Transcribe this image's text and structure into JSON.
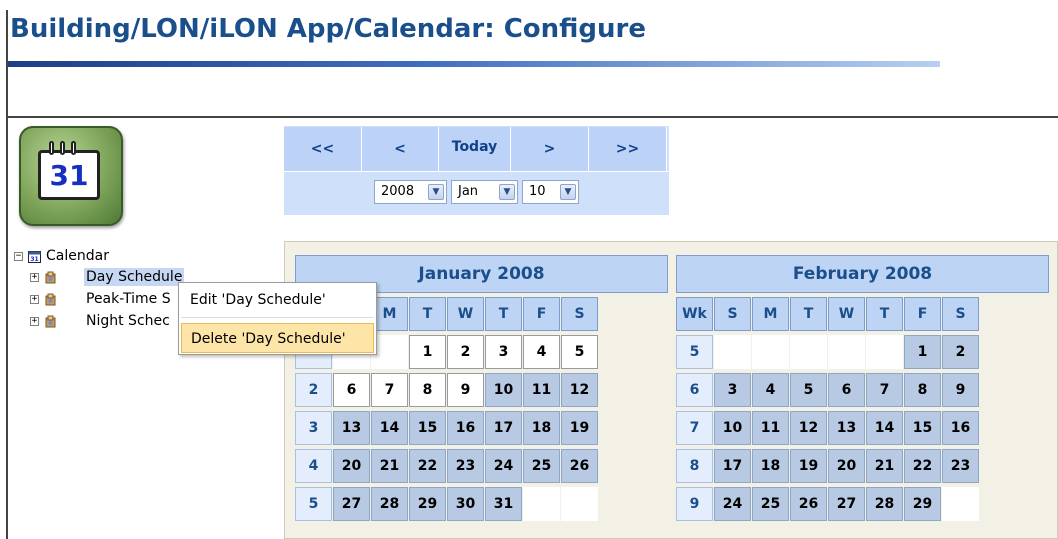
{
  "page": {
    "title": "Building/LON/iLON App/Calendar: Configure",
    "icon_day": "31"
  },
  "colors": {
    "title": "#1a4f8c",
    "nav_bg": "#cfe0fb",
    "header_cell": "#bdd4f5",
    "day_cell": "#b8cae3",
    "menu_hover": "#fde5a8"
  },
  "nav": {
    "first": "<<",
    "prev": "<",
    "today": "Today",
    "next": ">",
    "last": ">>",
    "year": "2008",
    "month": "Jan",
    "day": "10"
  },
  "tree": {
    "root": "Calendar",
    "items": [
      "Day Schedule",
      "Peak-Time S",
      "Night Schec"
    ]
  },
  "context_menu": {
    "items": [
      "Edit 'Day Schedule'",
      "Delete 'Day Schedule'"
    ],
    "hovered_index": 1
  },
  "calendar": {
    "weekday_headers": [
      "Wk",
      "S",
      "M",
      "T",
      "W",
      "T",
      "F",
      "S"
    ],
    "months": [
      {
        "title": "January 2008",
        "headers": [
          "",
          "S",
          "M",
          "T",
          "W",
          "T",
          "F",
          "S"
        ],
        "weeks": [
          {
            "wk": "",
            "days": [
              "",
              "",
              "1",
              "2",
              "3",
              "4",
              "5"
            ]
          },
          {
            "wk": "2",
            "days": [
              "6",
              "7",
              "8",
              "9",
              "10",
              "11",
              "12"
            ]
          },
          {
            "wk": "3",
            "days": [
              "13",
              "14",
              "15",
              "16",
              "17",
              "18",
              "19"
            ]
          },
          {
            "wk": "4",
            "days": [
              "20",
              "21",
              "22",
              "23",
              "24",
              "25",
              "26"
            ]
          },
          {
            "wk": "5",
            "days": [
              "27",
              "28",
              "29",
              "30",
              "31",
              "",
              ""
            ]
          }
        ],
        "past_through": "9"
      },
      {
        "title": "February 2008",
        "headers": [
          "Wk",
          "S",
          "M",
          "T",
          "W",
          "T",
          "F",
          "S"
        ],
        "weeks": [
          {
            "wk": "5",
            "days": [
              "",
              "",
              "",
              "",
              "",
              "1",
              "2"
            ]
          },
          {
            "wk": "6",
            "days": [
              "3",
              "4",
              "5",
              "6",
              "7",
              "8",
              "9"
            ]
          },
          {
            "wk": "7",
            "days": [
              "10",
              "11",
              "12",
              "13",
              "14",
              "15",
              "16"
            ]
          },
          {
            "wk": "8",
            "days": [
              "17",
              "18",
              "19",
              "20",
              "21",
              "22",
              "23"
            ]
          },
          {
            "wk": "9",
            "days": [
              "24",
              "25",
              "26",
              "27",
              "28",
              "29",
              ""
            ]
          }
        ],
        "past_through": ""
      }
    ]
  }
}
